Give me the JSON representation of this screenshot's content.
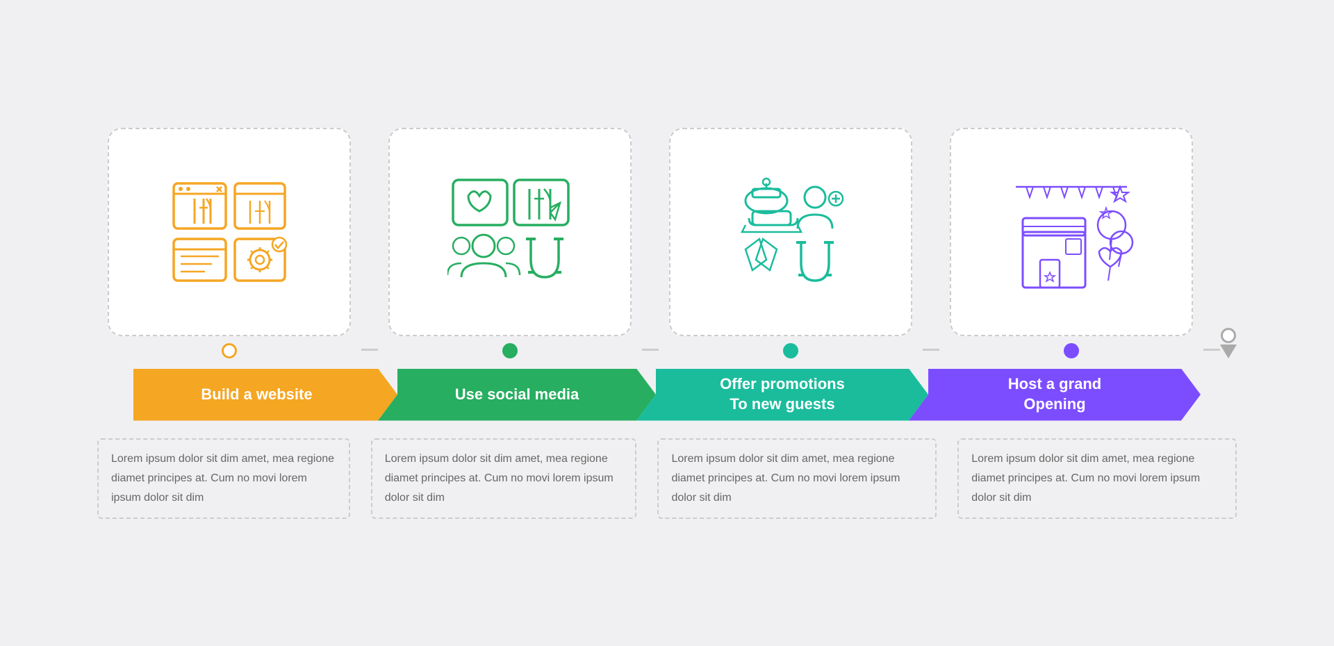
{
  "items": [
    {
      "id": "website",
      "color": "orange",
      "dot_color": "#f5a623",
      "arrow_color": "#f5a623",
      "title": "Build a website",
      "title_multiline": false,
      "description": "Lorem ipsum dolor sit dim amet, mea regione diamet principes at. Cum no movi lorem ipsum dolor sit dim"
    },
    {
      "id": "social",
      "color": "green",
      "dot_color": "#27ae60",
      "arrow_color": "#27ae60",
      "title": "Use social media",
      "title_multiline": false,
      "description": "Lorem ipsum dolor sit dim amet, mea regione diamet principes at. Cum no movi lorem ipsum dolor sit dim"
    },
    {
      "id": "promotions",
      "color": "teal",
      "dot_color": "#1abc9c",
      "arrow_color": "#1abc9c",
      "title": "Offer promotions\nTo new guests",
      "title_multiline": true,
      "description": "Lorem ipsum dolor sit dim amet, mea regione diamet principes at. Cum no movi lorem ipsum dolor sit dim"
    },
    {
      "id": "opening",
      "color": "purple",
      "dot_color": "#7c4dff",
      "arrow_color": "#7c4dff",
      "title": "Host a grand\nOpening",
      "title_multiline": true,
      "description": "Lorem ipsum dolor sit dim amet, mea regione diamet principes at. Cum no movi lorem ipsum dolor sit dim"
    }
  ]
}
